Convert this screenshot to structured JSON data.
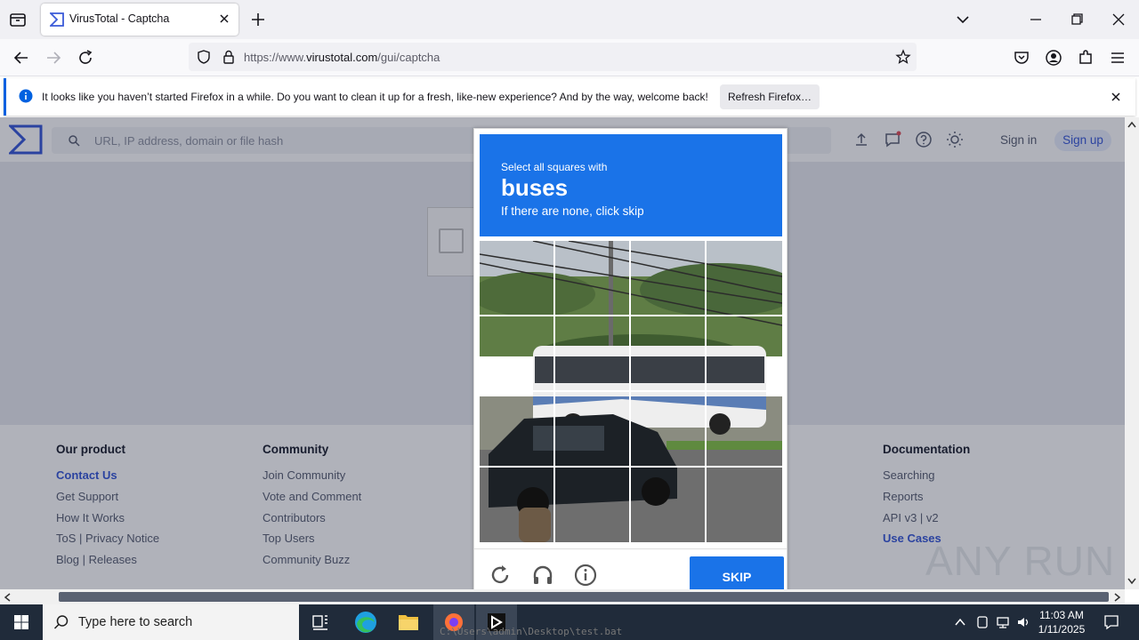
{
  "browser": {
    "tab_title": "VirusTotal - Captcha",
    "url_prefix": "https://www.",
    "url_domain": "virustotal.com",
    "url_path": "/gui/captcha"
  },
  "notification": {
    "message": "It looks like you haven’t started Firefox in a while. Do you want to clean it up for a fresh, like-new experience? And by the way, welcome back!",
    "button": "Refresh Firefox…"
  },
  "vt": {
    "search_placeholder": "URL, IP address, domain or file hash",
    "signin": "Sign in",
    "signup": "Sign up"
  },
  "footer": {
    "columns": [
      {
        "title": "Our product",
        "items": [
          "Contact Us",
          "Get Support",
          "How It Works",
          "ToS | Privacy Notice",
          "Blog | Releases"
        ]
      },
      {
        "title": "Community",
        "items": [
          "Join Community",
          "Vote and Comment",
          "Contributors",
          "Top Users",
          "Community Buzz"
        ]
      },
      {
        "title": "Documentation",
        "items": [
          "Searching",
          "Reports",
          "API v3 | v2",
          "Use Cases"
        ]
      }
    ]
  },
  "captcha": {
    "line1": "Select all squares with",
    "target": "buses",
    "line3": "If there are none, click skip",
    "skip": "SKIP"
  },
  "taskbar": {
    "search_placeholder": "Type here to search",
    "time": "11:03 AM",
    "date": "1/11/2025",
    "ghost_text": "C:\\Users\\admin\\Desktop\\test.bat"
  },
  "watermark": "ANY RUN",
  "colors": {
    "accent": "#1a73e8",
    "vt_blue": "#3a5ad8",
    "taskbar": "#202b3a"
  }
}
